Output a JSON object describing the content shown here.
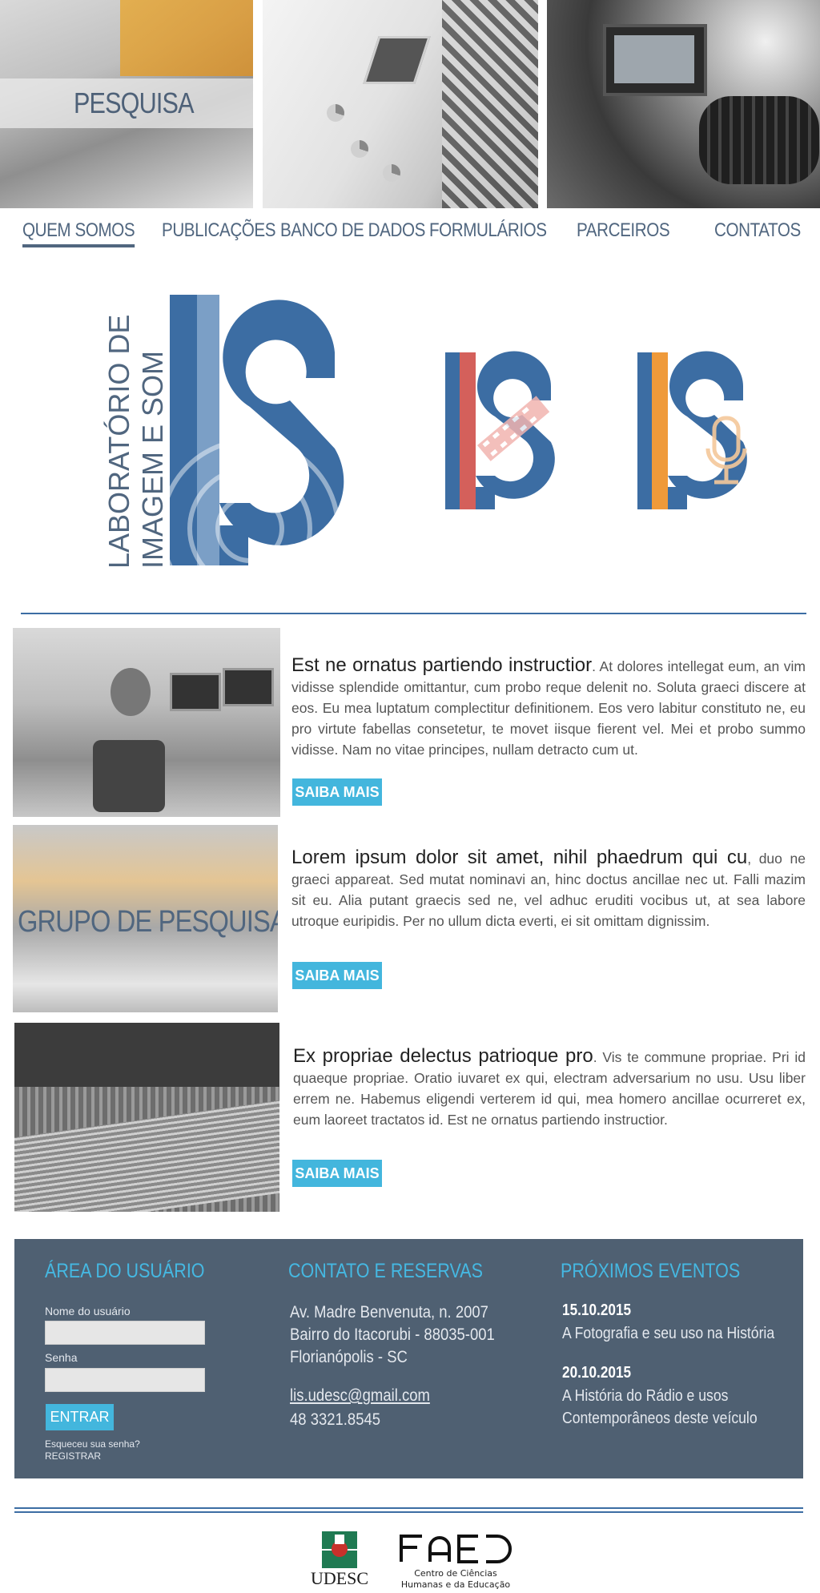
{
  "hero": {
    "caption": "PESQUISA"
  },
  "nav": {
    "items": [
      {
        "label": "QUEM SOMOS",
        "active": true
      },
      {
        "label": "PUBLICAÇÕES"
      },
      {
        "label": "BANCO DE DADOS"
      },
      {
        "label": "FORMULÁRIOS"
      },
      {
        "label": "PARCEIROS"
      },
      {
        "label": "CONTATOS"
      }
    ]
  },
  "brand": {
    "line1": "LABORATÓRIO DE",
    "line2": "IMAGEM E SOM",
    "primary_color": "#3c6da3",
    "light_color": "#7b9fc6",
    "red_color": "#d4605b",
    "orange_color": "#ef9a3a"
  },
  "content": {
    "button_label": "SAIBA MAIS",
    "rows": [
      {
        "lead": "Est ne ornatus partiendo instructior",
        "body": ". At dolores intellegat eum, an vim vidisse splendide omittantur, cum probo reque delenit no. Soluta graeci discere at eos. Eu mea luptatum complectitur definitionem. Eos vero labitur constituto ne, eu pro virtute fabellas consetetur, te movet iisque fierent vel. Mei et probo summo vidisse. Nam no vitae principes, nullam detracto cum ut."
      },
      {
        "image_caption": "GRUPO DE PESQUISA",
        "lead": "Lorem ipsum dolor sit amet, nihil phaedrum qui cu",
        "body": ", duo ne graeci appareat. Sed mutat nominavi an, hinc doctus ancillae nec ut. Falli mazim sit eu. Alia putant graecis sed ne, vel adhuc eruditi vocibus ut, at sea labore utroque euripidis. Per no ullum dicta everti, ei sit omittam dignissim."
      },
      {
        "lead": "Ex propriae delectus patrioque pro",
        "body": ". Vis te commune propriae. Pri id quaeque propriae. Oratio iuvaret ex qui, electram adversarium no usu. Usu liber errem ne. Habemus eligendi verterem id qui, mea homero ancillae ocurreret ex, eum laoreet tractatos id. Est ne ornatus partiendo instructior."
      }
    ]
  },
  "user_area": {
    "title": "ÁREA DO USUÁRIO",
    "username_label": "Nome do usuário",
    "username_value": "",
    "password_label": "Senha",
    "password_value": "",
    "submit_label": "ENTRAR",
    "forgot_label": "Esqueceu sua senha?",
    "register_label": "REGISTRAR"
  },
  "contact": {
    "title": "CONTATO E RESERVAS",
    "address_line1": "Av. Madre Benvenuta, n. 2007",
    "address_line2": "Bairro do Itacorubi - 88035-001",
    "address_line3": "Florianópolis - SC",
    "email": "lis.udesc@gmail.com",
    "phone": "48 3321.8545"
  },
  "events": {
    "title": "PRÓXIMOS EVENTOS",
    "items": [
      {
        "date": "15.10.2015",
        "title_line1": "A Fotografia e seu uso na História",
        "title_line2": ""
      },
      {
        "date": "20.10.2015",
        "title_line1": "A História do Rádio e usos",
        "title_line2": "Contemporâneos deste veículo"
      }
    ]
  },
  "sponsors": {
    "udesc": "UDESC",
    "faed_logo": "FAED",
    "faed_line1": "Centro de Ciências",
    "faed_line2": "Humanas e da Educação"
  },
  "colors": {
    "panel": "#4f6072",
    "accent": "#43b6dd",
    "nav_text": "#50667f"
  }
}
